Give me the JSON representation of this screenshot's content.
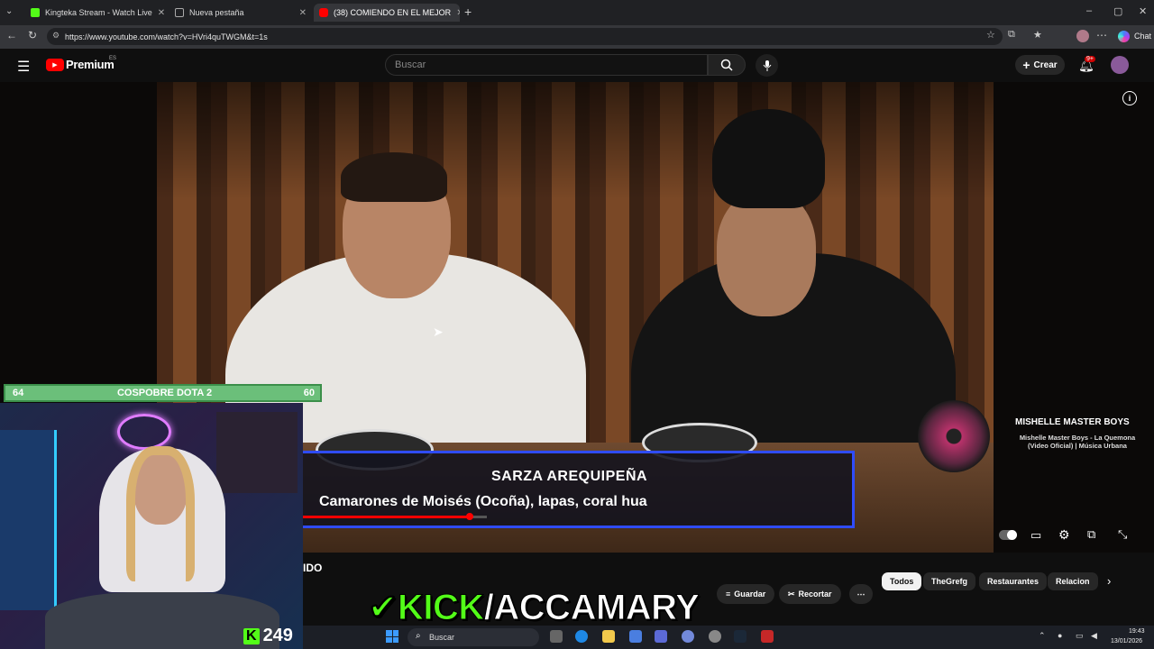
{
  "browser": {
    "tabs": [
      {
        "title": "Kingteka Stream - Watch Live",
        "active": false,
        "icon": "kick-icon"
      },
      {
        "title": "Nueva pestaña",
        "active": false,
        "icon": "new-tab-icon"
      },
      {
        "title": "(38) COMIENDO EN EL MEJOR",
        "active": true,
        "icon": "youtube-icon"
      }
    ],
    "url": "https://www.youtube.com/watch?v=HVri4quTWGM&t=1s",
    "chat_label": "Chat"
  },
  "youtube": {
    "logo_text": "Premium",
    "region": "ES",
    "search_placeholder": "Buscar",
    "create_label": "Crear",
    "notification_count": "9+"
  },
  "video": {
    "lower_third_title": "SARZA AREQUIPEÑA",
    "lower_third_subtitle": "Camarones de Moisés (Ocoña), lapas, coral hua",
    "progress_fraction": 0.9,
    "music_card": {
      "artist": "MISHELLE MASTER BOYS",
      "song_line1": "Mishelle Master Boys - La Quemona",
      "song_line2": "(Video Oficial) | Música Urbana"
    }
  },
  "overlay": {
    "bar_left": "64",
    "bar_title": "COSPOBRE DOTA 2",
    "bar_right": "60",
    "viewer_count": "249",
    "kick_banner_prefix": "KICK",
    "kick_banner_suffix": "/ACCAMARY"
  },
  "below_video": {
    "title_fragment": "IDO",
    "actions": [
      "Guardar",
      "Recortar"
    ],
    "chips": [
      "Todos",
      "TheGrefg",
      "Restaurantes",
      "Relacion"
    ]
  },
  "taskbar": {
    "search_label": "Buscar",
    "time": "19:43",
    "date": "13/01/2026"
  },
  "colors": {
    "youtube_red": "#ff0000",
    "kick_green": "#53fc18",
    "lower_third_border": "#2f4cff"
  }
}
